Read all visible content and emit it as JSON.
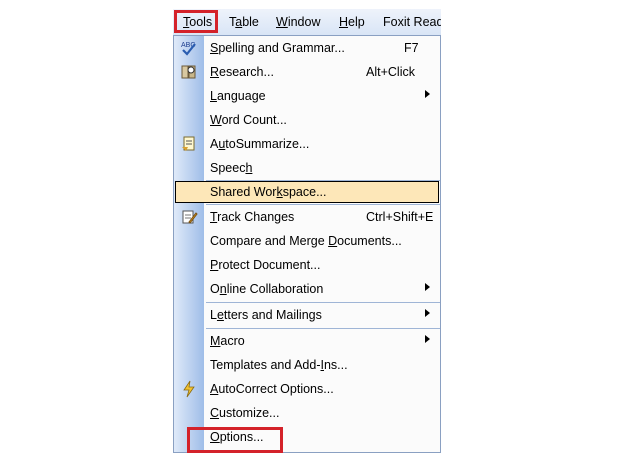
{
  "menubar": {
    "items": [
      {
        "label": "Tools",
        "underline": "T"
      },
      {
        "label": "Table",
        "underline": "a"
      },
      {
        "label": "Window",
        "underline": "W"
      },
      {
        "label": "Help",
        "underline": "H"
      },
      {
        "label": "Foxit Reader",
        "underline": ""
      }
    ],
    "highlight_color": "#d4222a"
  },
  "tools_menu": {
    "items": [
      {
        "label": "Spelling and Grammar...",
        "icon": "spelling-icon",
        "shortcut": "F7"
      },
      {
        "label": "Research...",
        "icon": "research-icon",
        "shortcut": "Alt+Click"
      },
      {
        "label": "Language",
        "submenu": true
      },
      {
        "label": "Word Count..."
      },
      {
        "label": "AutoSummarize...",
        "icon": "autosummarize-icon"
      },
      {
        "label": "Speech"
      },
      {
        "label": "Shared Workspace...",
        "highlighted": true
      },
      {
        "label": "Track Changes",
        "icon": "track-changes-icon",
        "shortcut": "Ctrl+Shift+E"
      },
      {
        "label": "Compare and Merge Documents..."
      },
      {
        "label": "Protect Document..."
      },
      {
        "label": "Online Collaboration",
        "submenu": true
      },
      {
        "label": "Letters and Mailings",
        "submenu": true
      },
      {
        "label": "Macro",
        "submenu": true
      },
      {
        "label": "Templates and Add-Ins..."
      },
      {
        "label": "AutoCorrect Options...",
        "icon": "lightning-icon"
      },
      {
        "label": "Customize..."
      },
      {
        "label": "Options...",
        "boxed": true
      }
    ],
    "hover_color": "#fde7b8"
  }
}
